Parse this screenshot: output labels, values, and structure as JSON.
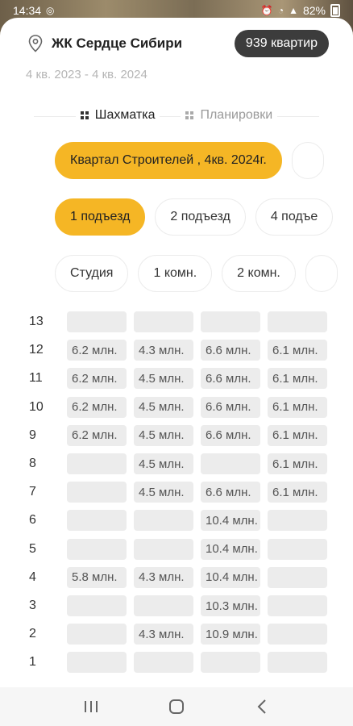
{
  "status": {
    "time": "14:34",
    "battery": "82%"
  },
  "header": {
    "title": "ЖК Сердце Сибири",
    "apartments_badge": "939 квартир",
    "dates": "4 кв. 2023 - 4 кв. 2024"
  },
  "tabs": [
    {
      "label": "Шахматка",
      "active": true
    },
    {
      "label": "Планировки",
      "active": false
    }
  ],
  "filters": {
    "quarter": [
      "Квартал Строителей , 4кв. 2024г.",
      ""
    ],
    "entrances": [
      "1 подъезд",
      "2 подъезд",
      "4 подъе"
    ],
    "rooms": [
      "Студия",
      "1 комн.",
      "2 комн.",
      ""
    ]
  },
  "floors": [
    {
      "floor": "13",
      "cells": [
        "",
        "",
        "",
        ""
      ]
    },
    {
      "floor": "12",
      "cells": [
        "6.2 млн.",
        "4.3 млн.",
        "6.6 млн.",
        "6.1 млн."
      ]
    },
    {
      "floor": "11",
      "cells": [
        "6.2 млн.",
        "4.5 млн.",
        "6.6 млн.",
        "6.1 млн."
      ]
    },
    {
      "floor": "10",
      "cells": [
        "6.2 млн.",
        "4.5 млн.",
        "6.6 млн.",
        "6.1 млн."
      ]
    },
    {
      "floor": "9",
      "cells": [
        "6.2 млн.",
        "4.5 млн.",
        "6.6 млн.",
        "6.1 млн."
      ]
    },
    {
      "floor": "8",
      "cells": [
        "",
        "4.5 млн.",
        "",
        "6.1 млн."
      ]
    },
    {
      "floor": "7",
      "cells": [
        "",
        "4.5 млн.",
        "6.6 млн.",
        "6.1 млн."
      ]
    },
    {
      "floor": "6",
      "cells": [
        "",
        "",
        "10.4 млн.",
        ""
      ]
    },
    {
      "floor": "5",
      "cells": [
        "",
        "",
        "10.4 млн.",
        ""
      ]
    },
    {
      "floor": "4",
      "cells": [
        "5.8 млн.",
        "4.3 млн.",
        "10.4 млн.",
        ""
      ]
    },
    {
      "floor": "3",
      "cells": [
        "",
        "",
        "10.3 млн.",
        ""
      ]
    },
    {
      "floor": "2",
      "cells": [
        "",
        "4.3 млн.",
        "10.9 млн.",
        ""
      ]
    },
    {
      "floor": "1",
      "cells": [
        "",
        "",
        "",
        ""
      ]
    }
  ],
  "colors": {
    "accent": "#f5b625",
    "badge": "#3c3c3c",
    "cell": "#ececec"
  }
}
